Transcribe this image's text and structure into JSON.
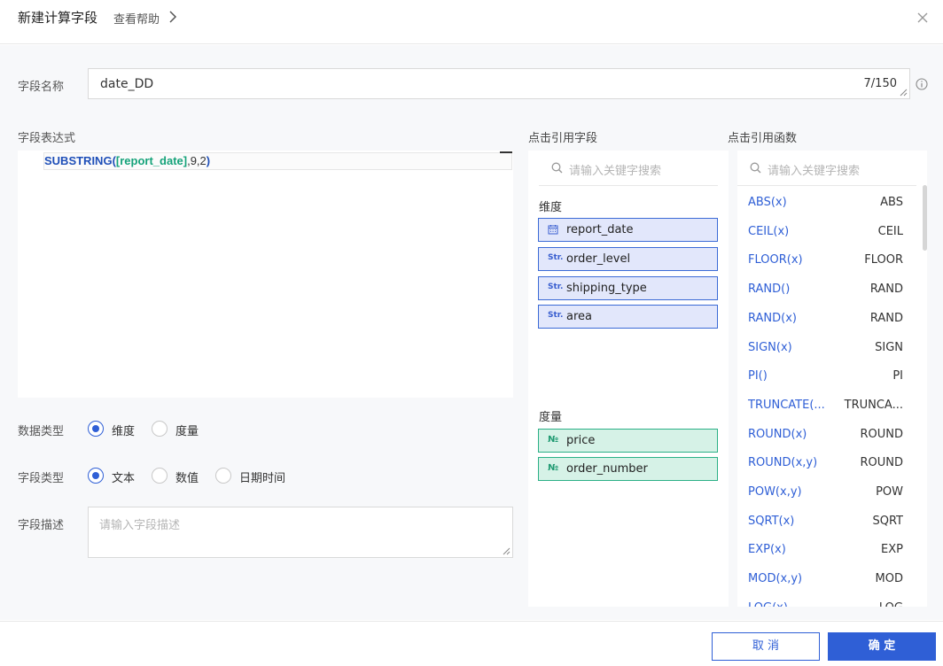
{
  "header": {
    "title": "新建计算字段",
    "help_link": "查看帮助"
  },
  "field_name": {
    "label": "字段名称",
    "value": "date_DD",
    "counter": "7/150"
  },
  "expression": {
    "label": "字段表达式",
    "fn_name": "SUBSTRING",
    "open_paren": "(",
    "field_ref": "[report_date]",
    "args": ",9,2",
    "close_paren": ")"
  },
  "data_type": {
    "label": "数据类型",
    "options": [
      "维度",
      "度量"
    ],
    "selected": "维度"
  },
  "field_type": {
    "label": "字段类型",
    "options": [
      "文本",
      "数值",
      "日期时间"
    ],
    "selected": "文本"
  },
  "description": {
    "label": "字段描述",
    "placeholder": "请输入字段描述"
  },
  "fields_panel": {
    "title": "点击引用字段",
    "search_placeholder": "请输入关键字搜索",
    "dimension_title": "维度",
    "dimensions": [
      {
        "icon": "calendar-icon",
        "name": "report_date"
      },
      {
        "icon": "str-icon",
        "name": "order_level"
      },
      {
        "icon": "str-icon",
        "name": "shipping_type"
      },
      {
        "icon": "str-icon",
        "name": "area"
      }
    ],
    "measure_title": "度量",
    "measures": [
      {
        "icon": "number-icon",
        "name": "price"
      },
      {
        "icon": "number-icon",
        "name": "order_number"
      }
    ],
    "str_glyph": "Str.",
    "num_glyph": "№"
  },
  "functions_panel": {
    "title": "点击引用函数",
    "search_placeholder": "请输入关键字搜索",
    "functions": [
      {
        "signature": "ABS(x)",
        "name": "ABS"
      },
      {
        "signature": "CEIL(x)",
        "name": "CEIL"
      },
      {
        "signature": "FLOOR(x)",
        "name": "FLOOR"
      },
      {
        "signature": "RAND()",
        "name": "RAND"
      },
      {
        "signature": "RAND(x)",
        "name": "RAND"
      },
      {
        "signature": "SIGN(x)",
        "name": "SIGN"
      },
      {
        "signature": "PI()",
        "name": "PI"
      },
      {
        "signature": "TRUNCATE(...",
        "name": "TRUNCA..."
      },
      {
        "signature": "ROUND(x)",
        "name": "ROUND"
      },
      {
        "signature": "ROUND(x,y)",
        "name": "ROUND"
      },
      {
        "signature": "POW(x,y)",
        "name": "POW"
      },
      {
        "signature": "SQRT(x)",
        "name": "SQRT"
      },
      {
        "signature": "EXP(x)",
        "name": "EXP"
      },
      {
        "signature": "MOD(x,y)",
        "name": "MOD"
      },
      {
        "signature": "LOG(x)",
        "name": "LOG"
      }
    ]
  },
  "footer": {
    "cancel_label": "取 消",
    "ok_label": "确 定"
  },
  "colors": {
    "accent": "#2f5fd6",
    "dimension_bg": "#e2e7fb",
    "measure_bg": "#d6f2e7",
    "measure_border": "#2bb086"
  }
}
